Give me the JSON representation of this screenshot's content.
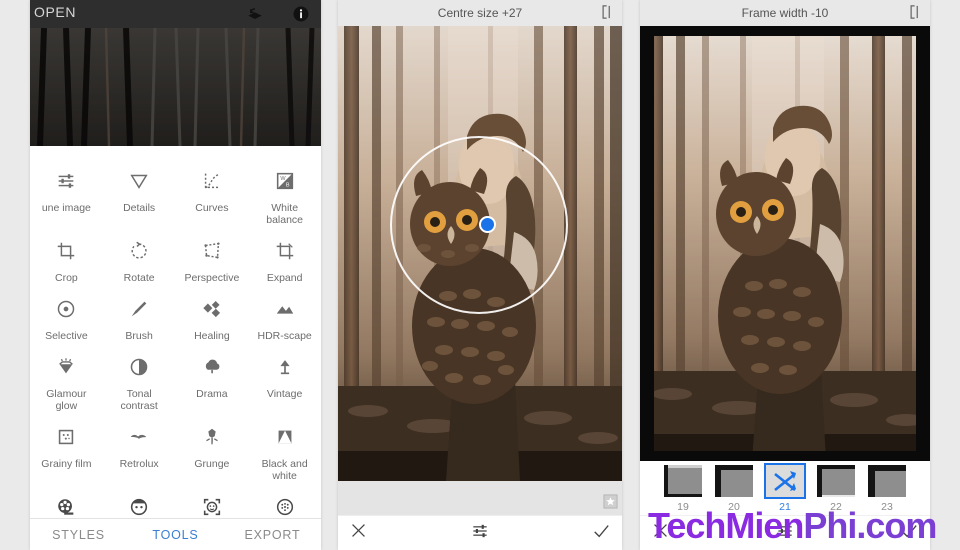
{
  "left_panel": {
    "topbar": {
      "open_label": "OPEN",
      "icons": [
        "undo-stack-icon",
        "info-icon"
      ]
    },
    "tools_rows": [
      [
        {
          "label": "une image",
          "icon": "tune-image-icon"
        },
        {
          "label": "Details",
          "icon": "details-icon"
        },
        {
          "label": "Curves",
          "icon": "curves-icon"
        },
        {
          "label": "White\nbalance",
          "icon": "white-balance-icon"
        }
      ],
      [
        {
          "label": "Crop",
          "icon": "crop-icon"
        },
        {
          "label": "Rotate",
          "icon": "rotate-icon"
        },
        {
          "label": "Perspective",
          "icon": "perspective-icon"
        },
        {
          "label": "Expand",
          "icon": "expand-icon"
        }
      ],
      [
        {
          "label": "Selective",
          "icon": "selective-icon"
        },
        {
          "label": "Brush",
          "icon": "brush-icon"
        },
        {
          "label": "Healing",
          "icon": "healing-icon"
        },
        {
          "label": "HDR-scape",
          "icon": "hdr-scape-icon"
        }
      ],
      [
        {
          "label": "Glamour\nglow",
          "icon": "glamour-glow-icon"
        },
        {
          "label": "Tonal\ncontrast",
          "icon": "tonal-contrast-icon"
        },
        {
          "label": "Drama",
          "icon": "drama-icon"
        },
        {
          "label": "Vintage",
          "icon": "vintage-icon"
        }
      ],
      [
        {
          "label": "Grainy film",
          "icon": "grainy-film-icon"
        },
        {
          "label": "Retrolux",
          "icon": "retrolux-icon"
        },
        {
          "label": "Grunge",
          "icon": "grunge-icon"
        },
        {
          "label": "Black and\nwhite",
          "icon": "black-and-white-icon"
        }
      ],
      [
        {
          "label": "",
          "icon": "film-reel-icon"
        },
        {
          "label": "",
          "icon": "portrait-icon"
        },
        {
          "label": "",
          "icon": "head-pose-icon"
        },
        {
          "label": "",
          "icon": "lens-blur-icon"
        }
      ]
    ],
    "tabs": [
      {
        "label": "STYLES",
        "active": false
      },
      {
        "label": "TOOLS",
        "active": true
      },
      {
        "label": "EXPORT",
        "active": false
      }
    ],
    "tab_active_color": "#3b7fd4"
  },
  "middle_panel": {
    "title": "Centre size +27",
    "compare_icon": "compare-icon",
    "selective_control": {
      "handle_icon": "control-point-handle",
      "handle_color": "#1a73e8"
    },
    "badge_icon": "star-badge-icon",
    "bottom": {
      "cancel_icon": "close-icon",
      "adjust_icon": "adjust-sliders-icon",
      "accept_icon": "check-icon"
    }
  },
  "right_panel": {
    "title": "Frame width -10",
    "compare_icon": "compare-icon",
    "frames": [
      {
        "number": "19",
        "selected": false
      },
      {
        "number": "20",
        "selected": false
      },
      {
        "number": "21",
        "selected": true,
        "icon": "shuffle-icon"
      },
      {
        "number": "22",
        "selected": false
      },
      {
        "number": "23",
        "selected": false
      }
    ],
    "selected_color": "#1a73e8",
    "bottom": {
      "cancel_icon": "close-icon",
      "adjust_icon": "adjust-sliders-icon",
      "accept_icon": "check-icon"
    }
  },
  "watermark": {
    "part_a": "TechMien",
    "part_b": "Phi.com",
    "color": "#8a2be2"
  }
}
